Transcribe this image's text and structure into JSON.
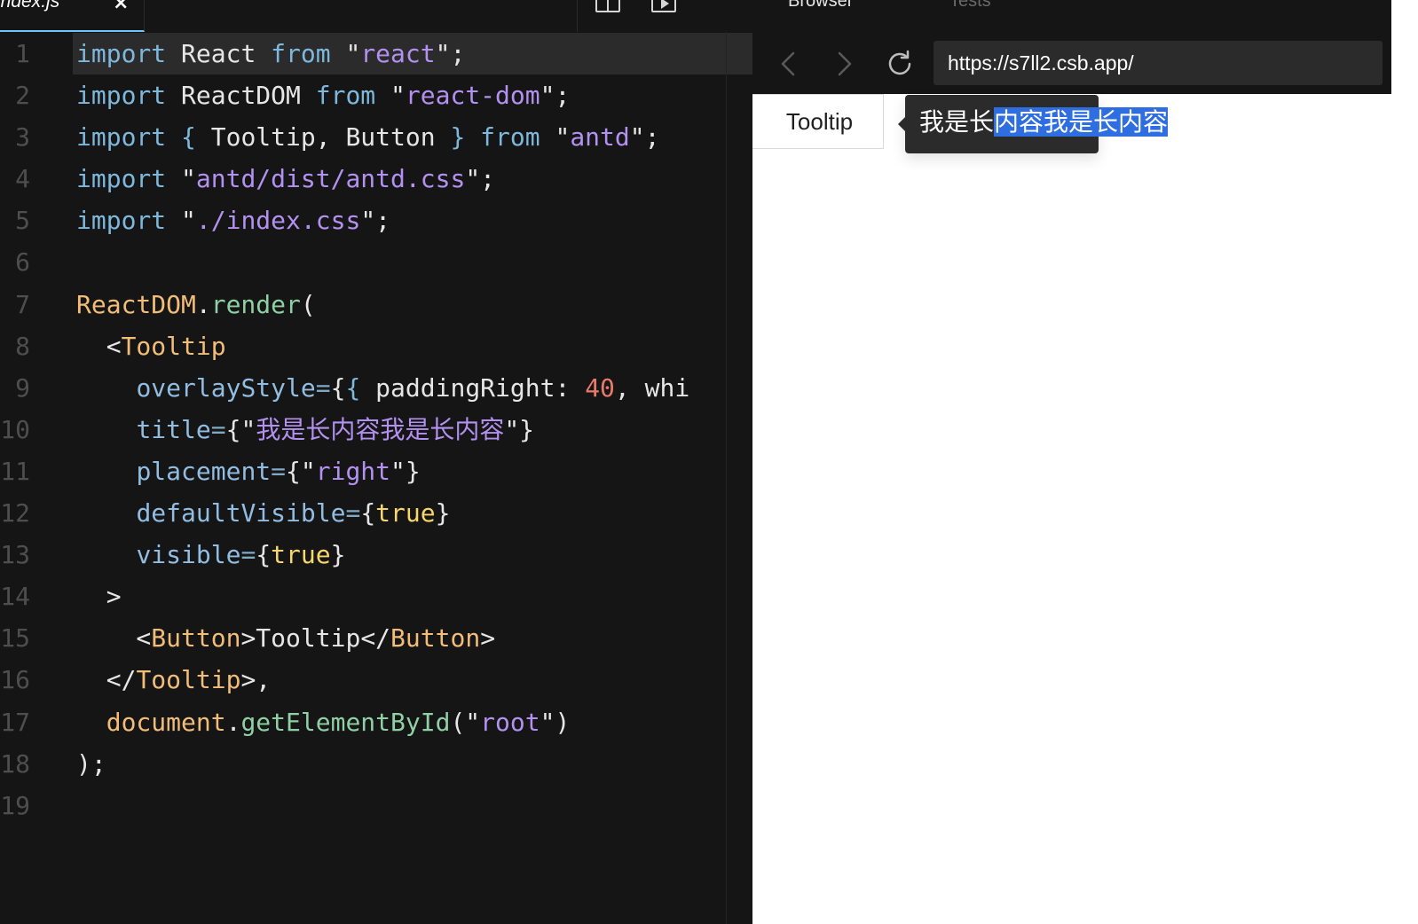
{
  "editor": {
    "tab": {
      "filename": "index.js",
      "close": "×"
    },
    "toolbar": {
      "more": "•••"
    },
    "lines": [
      {
        "n": "1",
        "parts": [
          [
            "kw",
            "import"
          ],
          [
            "punc",
            " React "
          ],
          [
            "kw",
            "from"
          ],
          [
            "punc",
            " \""
          ],
          [
            "str",
            "react"
          ],
          [
            "punc",
            "\";"
          ]
        ]
      },
      {
        "n": "2",
        "parts": [
          [
            "kw",
            "import"
          ],
          [
            "punc",
            " ReactDOM "
          ],
          [
            "kw",
            "from"
          ],
          [
            "punc",
            " \""
          ],
          [
            "str",
            "react-dom"
          ],
          [
            "punc",
            "\";"
          ]
        ]
      },
      {
        "n": "3",
        "parts": [
          [
            "kw",
            "import"
          ],
          [
            "punc",
            " "
          ],
          [
            "kw",
            "{"
          ],
          [
            "punc",
            " Tooltip, Button "
          ],
          [
            "kw",
            "}"
          ],
          [
            "punc",
            " "
          ],
          [
            "kw",
            "from"
          ],
          [
            "punc",
            " \""
          ],
          [
            "str",
            "antd"
          ],
          [
            "punc",
            "\";"
          ]
        ]
      },
      {
        "n": "4",
        "parts": [
          [
            "kw",
            "import"
          ],
          [
            "punc",
            " \""
          ],
          [
            "str",
            "antd/dist/antd.css"
          ],
          [
            "punc",
            "\";"
          ]
        ]
      },
      {
        "n": "5",
        "parts": [
          [
            "kw",
            "import"
          ],
          [
            "punc",
            " \""
          ],
          [
            "str",
            "./index.css"
          ],
          [
            "punc",
            "\";"
          ]
        ]
      },
      {
        "n": "6",
        "parts": []
      },
      {
        "n": "7",
        "parts": [
          [
            "obj",
            "ReactDOM"
          ],
          [
            "punc",
            "."
          ],
          [
            "fn",
            "render"
          ],
          [
            "punc",
            "("
          ]
        ]
      },
      {
        "n": "8",
        "parts": [
          [
            "punc",
            "  <"
          ],
          [
            "tag",
            "Tooltip"
          ]
        ]
      },
      {
        "n": "9",
        "parts": [
          [
            "punc",
            "    "
          ],
          [
            "attr",
            "overlayStyle"
          ],
          [
            "op",
            "="
          ],
          [
            "punc",
            "{"
          ],
          [
            "kw",
            "{"
          ],
          [
            "punc",
            " paddingRight: "
          ],
          [
            "num",
            "40"
          ],
          [
            "punc",
            ", whi"
          ]
        ]
      },
      {
        "n": "10",
        "parts": [
          [
            "punc",
            "    "
          ],
          [
            "attr",
            "title"
          ],
          [
            "op",
            "="
          ],
          [
            "punc",
            "{\""
          ],
          [
            "str",
            "我是长内容我是长内容"
          ],
          [
            "punc",
            "\"}"
          ]
        ]
      },
      {
        "n": "11",
        "parts": [
          [
            "punc",
            "    "
          ],
          [
            "attr",
            "placement"
          ],
          [
            "op",
            "="
          ],
          [
            "punc",
            "{\""
          ],
          [
            "str",
            "right"
          ],
          [
            "punc",
            "\"}"
          ]
        ]
      },
      {
        "n": "12",
        "parts": [
          [
            "punc",
            "    "
          ],
          [
            "attr",
            "defaultVisible"
          ],
          [
            "op",
            "="
          ],
          [
            "punc",
            "{"
          ],
          [
            "bool",
            "true"
          ],
          [
            "punc",
            "}"
          ]
        ]
      },
      {
        "n": "13",
        "parts": [
          [
            "punc",
            "    "
          ],
          [
            "attr",
            "visible"
          ],
          [
            "op",
            "="
          ],
          [
            "punc",
            "{"
          ],
          [
            "bool",
            "true"
          ],
          [
            "punc",
            "}"
          ]
        ]
      },
      {
        "n": "14",
        "parts": [
          [
            "punc",
            "  >"
          ]
        ]
      },
      {
        "n": "15",
        "parts": [
          [
            "punc",
            "    <"
          ],
          [
            "tag",
            "Button"
          ],
          [
            "punc",
            ">Tooltip</"
          ],
          [
            "tag",
            "Button"
          ],
          [
            "punc",
            ">"
          ]
        ]
      },
      {
        "n": "16",
        "parts": [
          [
            "punc",
            "  </"
          ],
          [
            "tag",
            "Tooltip"
          ],
          [
            "punc",
            ">,"
          ]
        ]
      },
      {
        "n": "17",
        "parts": [
          [
            "punc",
            "  "
          ],
          [
            "obj",
            "document"
          ],
          [
            "punc",
            "."
          ],
          [
            "fn",
            "getElementById"
          ],
          [
            "punc",
            "(\""
          ],
          [
            "str",
            "root"
          ],
          [
            "punc",
            "\")"
          ]
        ]
      },
      {
        "n": "18",
        "parts": [
          [
            "punc",
            ");"
          ]
        ]
      },
      {
        "n": "19",
        "parts": []
      }
    ]
  },
  "browser": {
    "tabs": {
      "browser": "Browser",
      "tests": "Tests"
    },
    "url": "https://s7ll2.csb.app/",
    "preview": {
      "button_label": "Tooltip",
      "tooltip_plain": "我是长",
      "tooltip_selected": "内容我是长内容"
    }
  },
  "icons": {
    "split": "split-view-icon",
    "preview": "preview-icon",
    "more": "more-icon",
    "back": "chevron-left-icon",
    "forward": "chevron-right-icon",
    "reload": "reload-icon"
  }
}
